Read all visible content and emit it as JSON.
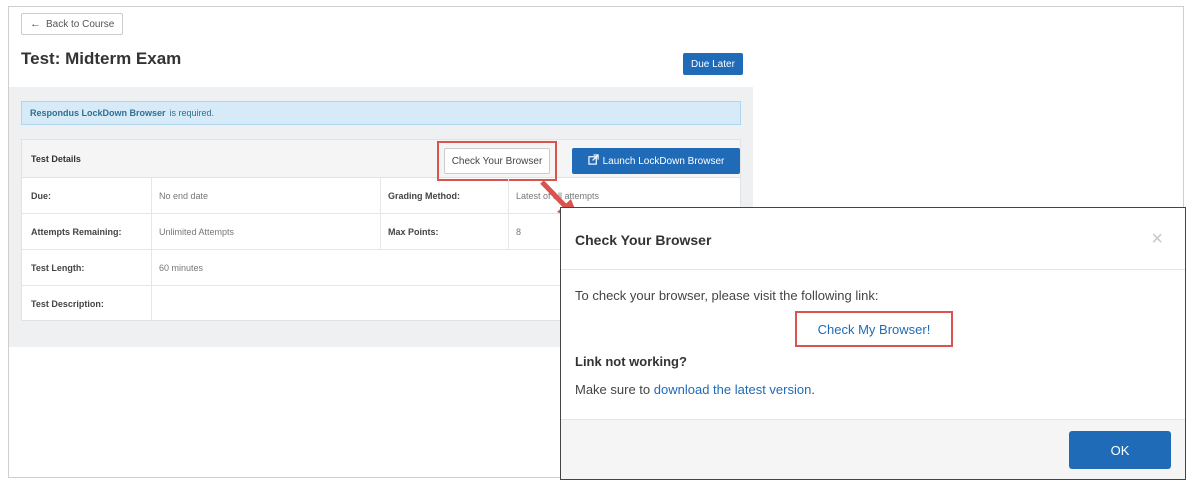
{
  "back_button": {
    "label": "Back to Course"
  },
  "page": {
    "title": "Test: Midterm Exam",
    "due_badge": "Due Later"
  },
  "alert": {
    "strong": "Respondus LockDown Browser",
    "rest": "is required."
  },
  "details": {
    "title": "Test Details",
    "check_button": "Check Your Browser",
    "launch_button": "Launch LockDown Browser",
    "rows": [
      {
        "label": "Due:",
        "value": "No end date",
        "label2": "Grading Method:",
        "value2": "Latest of all attempts"
      },
      {
        "label": "Attempts Remaining:",
        "value": "Unlimited Attempts",
        "label2": "Max Points:",
        "value2": "8"
      },
      {
        "label": "Test Length:",
        "value": "60 minutes",
        "label2": "",
        "value2": ""
      },
      {
        "label": "Test Description:",
        "value": "",
        "label2": "",
        "value2": ""
      }
    ]
  },
  "modal": {
    "title": "Check Your Browser",
    "close": "×",
    "instruction": "To check your browser, please visit the following link:",
    "link": "Check My Browser!",
    "subhead": "Link not working?",
    "make_sure": "Make sure to",
    "download_link": "download the latest version",
    "period": ".",
    "ok": "OK"
  },
  "colors": {
    "primary": "#1f6bb8",
    "highlight": "#d9534f",
    "alert_bg": "#d6eaf8"
  }
}
